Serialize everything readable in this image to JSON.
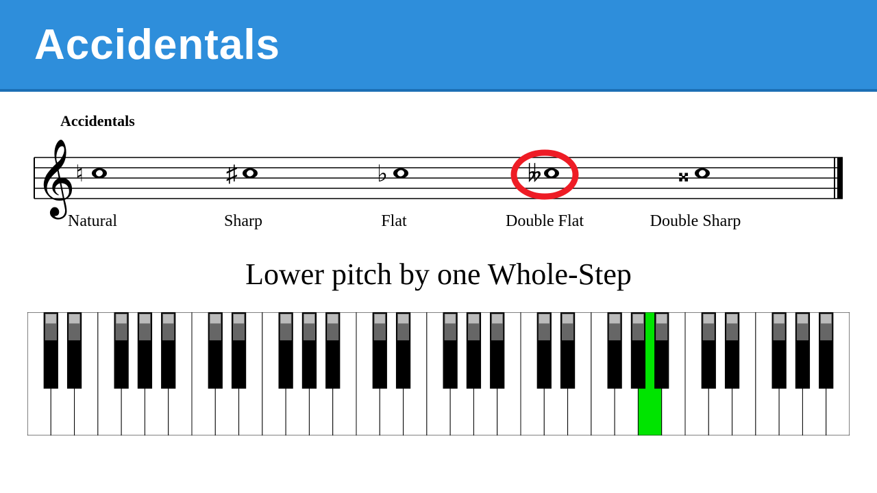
{
  "header": {
    "title": "Accidentals"
  },
  "staff": {
    "title": "Accidentals",
    "items": [
      {
        "label": "Natural",
        "glyph": "♮"
      },
      {
        "label": "Sharp",
        "glyph": "♯"
      },
      {
        "label": "Flat",
        "glyph": "♭"
      },
      {
        "label": "Double Flat",
        "glyph": "𝄫"
      },
      {
        "label": "Double Sharp",
        "glyph": "𝄪"
      }
    ],
    "highlighted_index": 3
  },
  "description": "Lower pitch by one Whole-Step",
  "keyboard": {
    "highlighted_white_key_index": 26
  }
}
